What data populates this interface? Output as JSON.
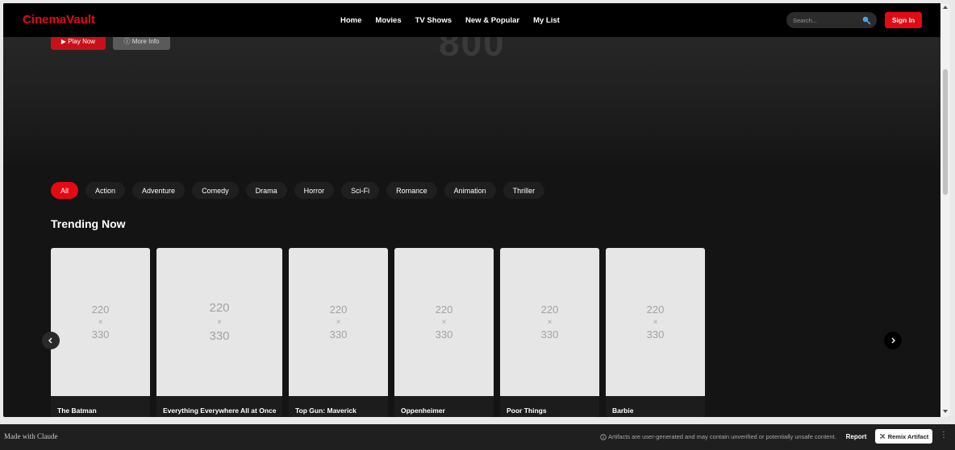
{
  "app": {
    "logo": "CinemaVault"
  },
  "hero": {
    "play_label": "▶ Play Now",
    "info_label": "ⓘ More Info",
    "bg_text": "800"
  },
  "nav": {
    "items": [
      "Home",
      "Movies",
      "TV Shows",
      "New & Popular",
      "My List"
    ]
  },
  "search": {
    "placeholder": "Search..."
  },
  "auth": {
    "signin_label": "Sign In"
  },
  "genres": {
    "active": "All",
    "items": [
      "All",
      "Action",
      "Adventure",
      "Comedy",
      "Drama",
      "Horror",
      "Sci-Fi",
      "Romance",
      "Animation",
      "Thriller"
    ]
  },
  "trending": {
    "title": "Trending Now",
    "placeholder_w": "220",
    "placeholder_x": "×",
    "placeholder_h": "330",
    "movies": [
      "The Batman",
      "Everything Everywhere All at Once",
      "Top Gun: Maverick",
      "Oppenheimer",
      "Poor Things",
      "Barbie"
    ]
  },
  "footer": {
    "made_with": "Made with Claude",
    "disclaimer": "Artifacts are user-generated and may contain unverified or potentially unsafe content.",
    "report_label": "Report",
    "remix_label": "Remix Artifact",
    "more_glyph": "⋮"
  },
  "colors": {
    "brand_red": "#e50914",
    "background": "#141414",
    "poster_placeholder": "#e6e6e6"
  },
  "icons": {
    "search": "search-icon",
    "left": "chevron-left-icon",
    "right": "chevron-right-icon"
  }
}
